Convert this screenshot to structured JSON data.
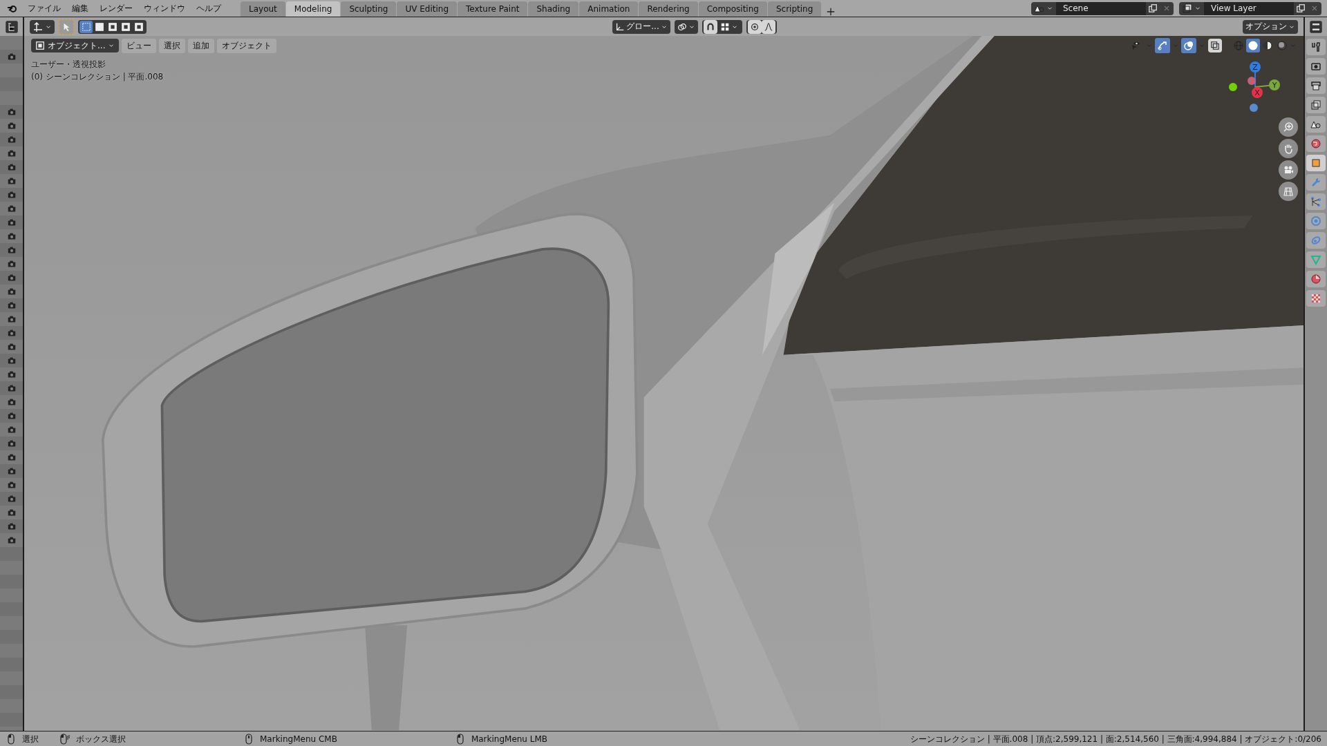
{
  "menu_bar": {
    "items": [
      "ファイル",
      "編集",
      "レンダー",
      "ウィンドウ",
      "ヘルプ"
    ]
  },
  "workspace_tabs": [
    {
      "label": "Layout",
      "selected": false
    },
    {
      "label": "Modeling",
      "selected": true
    },
    {
      "label": "Sculpting",
      "selected": false
    },
    {
      "label": "UV Editing",
      "selected": false
    },
    {
      "label": "Texture Paint",
      "selected": false
    },
    {
      "label": "Shading",
      "selected": false
    },
    {
      "label": "Animation",
      "selected": false
    },
    {
      "label": "Rendering",
      "selected": false
    },
    {
      "label": "Compositing",
      "selected": false
    },
    {
      "label": "Scripting",
      "selected": false
    }
  ],
  "scene": {
    "name": "Scene"
  },
  "view_layer": {
    "name": "View Layer"
  },
  "tool_header": {
    "select_modes": [
      {
        "selected": true
      },
      {
        "selected": false
      },
      {
        "selected": false
      },
      {
        "selected": false
      },
      {
        "selected": false
      }
    ],
    "transform_orientation": "グロー...",
    "options": "オプション"
  },
  "viewport": {
    "mode": "オブジェクト...",
    "menus": [
      "ビュー",
      "選択",
      "追加",
      "オブジェクト"
    ],
    "view_name": "ユーザー・透視投影",
    "collection_info": "(0) シーンコレクション | 平面.008",
    "toggles": [
      {
        "kind": "visibility",
        "on": false
      },
      {
        "kind": "gizmo",
        "on": true
      },
      {
        "kind": "overlay",
        "on": true
      }
    ],
    "shading_modes": [
      {
        "kind": "wireframe",
        "selected": false
      },
      {
        "kind": "solid",
        "selected": true
      },
      {
        "kind": "material",
        "selected": false
      },
      {
        "kind": "rendered",
        "selected": false
      }
    ],
    "gizmo_axes": [
      "Z",
      "Y",
      "X"
    ]
  },
  "outliner": {
    "rows": [
      {
        "kind": "blank"
      },
      {
        "kind": "camera"
      },
      {
        "kind": "blank"
      },
      {
        "kind": "blank"
      },
      {
        "kind": "blank"
      },
      {
        "kind": "camera"
      },
      {
        "kind": "camera"
      },
      {
        "kind": "camera"
      },
      {
        "kind": "camera"
      },
      {
        "kind": "camera"
      },
      {
        "kind": "camera"
      },
      {
        "kind": "camera"
      },
      {
        "kind": "camera"
      },
      {
        "kind": "camera"
      },
      {
        "kind": "camera"
      },
      {
        "kind": "camera"
      },
      {
        "kind": "camera"
      },
      {
        "kind": "camera"
      },
      {
        "kind": "camera"
      },
      {
        "kind": "camera"
      },
      {
        "kind": "camera"
      },
      {
        "kind": "camera"
      },
      {
        "kind": "camera"
      },
      {
        "kind": "camera"
      },
      {
        "kind": "camera"
      },
      {
        "kind": "camera"
      },
      {
        "kind": "camera"
      },
      {
        "kind": "camera"
      },
      {
        "kind": "camera"
      },
      {
        "kind": "camera"
      },
      {
        "kind": "camera"
      },
      {
        "kind": "camera"
      },
      {
        "kind": "camera"
      },
      {
        "kind": "camera"
      },
      {
        "kind": "camera"
      },
      {
        "kind": "camera"
      },
      {
        "kind": "camera"
      }
    ]
  },
  "properties_tabs": [
    {
      "kind": "tool",
      "selected": false
    },
    {
      "kind": "render",
      "selected": false
    },
    {
      "kind": "output",
      "selected": false
    },
    {
      "kind": "view_layer",
      "selected": false
    },
    {
      "kind": "scene",
      "selected": false
    },
    {
      "kind": "world",
      "selected": false
    },
    {
      "kind": "object",
      "selected": true
    },
    {
      "kind": "modifiers",
      "selected": false
    },
    {
      "kind": "particles",
      "selected": false
    },
    {
      "kind": "physics",
      "selected": false
    },
    {
      "kind": "constraints",
      "selected": false
    },
    {
      "kind": "data",
      "selected": false
    },
    {
      "kind": "material",
      "selected": false
    },
    {
      "kind": "texture",
      "selected": false
    }
  ],
  "status_bar": {
    "hints": [
      {
        "kind": "lmb",
        "label": "選択"
      },
      {
        "kind": "lmb_drag",
        "label": "ボックス選択"
      },
      {
        "kind": "mmb",
        "label": "MarkingMenu CMB"
      },
      {
        "kind": "lmb",
        "label": "MarkingMenu LMB"
      }
    ],
    "stats": "シーンコレクション | 平面.008 | 頂点:2,599,121 | 面:2,514,560 | 三角面:4,994,884 | オブジェクト:0/206"
  }
}
